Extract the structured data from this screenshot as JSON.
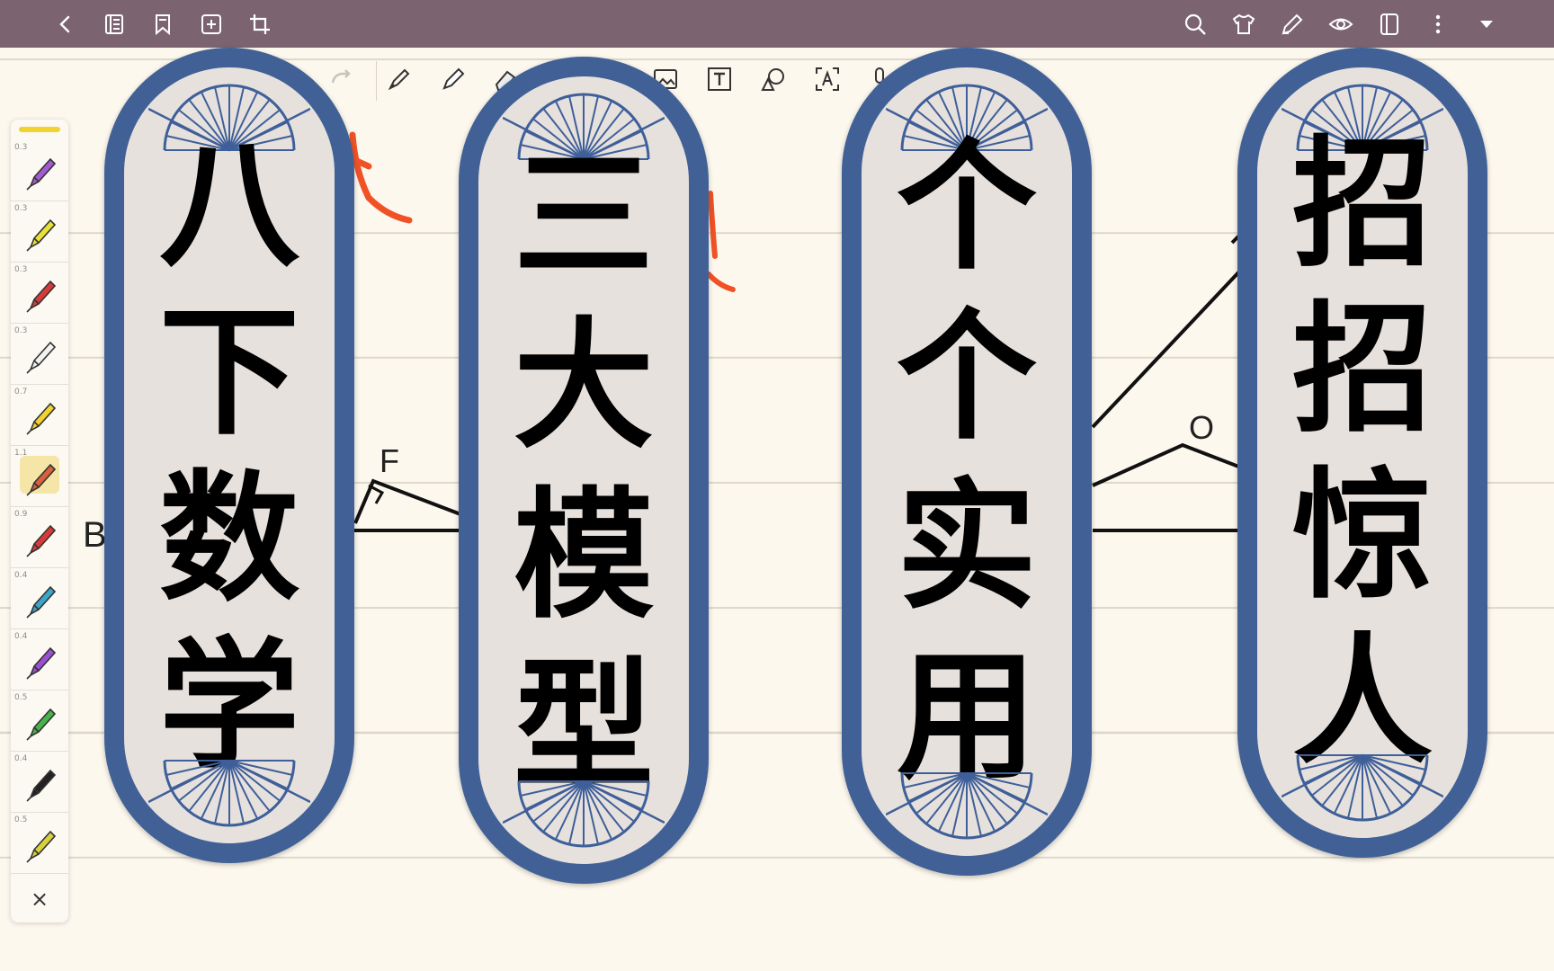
{
  "topbar": {
    "background": "#7b6470",
    "left_icons": [
      "back-icon",
      "outline-icon",
      "bookmark-icon",
      "add-page-icon",
      "crop-icon"
    ],
    "right_icons": [
      "search-icon",
      "shirt-icon",
      "pen-mode-icon",
      "eye-icon",
      "page-view-icon",
      "more-icon",
      "dropdown-icon"
    ]
  },
  "toolbar2": {
    "icons": [
      "redo-icon",
      "pen-tool-icon",
      "fountain-pen-icon",
      "eraser-icon",
      "image-icon",
      "text-box-icon",
      "shape-icon",
      "text-recognition-icon",
      "mic-icon"
    ]
  },
  "palette": {
    "pens": [
      {
        "size": "0.3",
        "color": "#a45ad1",
        "icon": "fineliner-icon"
      },
      {
        "size": "0.3",
        "color": "#e9e03a",
        "icon": "fineliner-icon"
      },
      {
        "size": "0.3",
        "color": "#d83a3a",
        "icon": "fineliner-icon"
      },
      {
        "size": "0.3",
        "color": "#f2f2f2",
        "icon": "fineliner-icon"
      },
      {
        "size": "0.7",
        "color": "#f1d32f",
        "icon": "highlighter-icon"
      },
      {
        "size": "1.1",
        "color": "#d8613a",
        "icon": "brush-pen-icon",
        "active": true
      },
      {
        "size": "0.9",
        "color": "#d83a3a",
        "icon": "ballpoint-icon"
      },
      {
        "size": "0.4",
        "color": "#3aa6c9",
        "icon": "ballpoint-icon"
      },
      {
        "size": "0.4",
        "color": "#9b4fd1",
        "icon": "ballpoint-icon"
      },
      {
        "size": "0.5",
        "color": "#45b347",
        "icon": "ballpoint-icon"
      },
      {
        "size": "0.4",
        "color": "#222222",
        "icon": "ballpoint-icon"
      },
      {
        "size": "0.5",
        "color": "#d7d23c",
        "icon": "ballpoint-icon"
      }
    ],
    "close_label": "×"
  },
  "drawing": {
    "labels": {
      "b": "B",
      "f": "F",
      "o": "O"
    }
  },
  "banners": [
    {
      "chars": [
        "八",
        "下",
        "数",
        "学"
      ]
    },
    {
      "chars": [
        "三",
        "大",
        "模",
        "型"
      ]
    },
    {
      "chars": [
        "个",
        "个",
        "实",
        "用"
      ]
    },
    {
      "chars": [
        "招",
        "招",
        "惊",
        "人"
      ]
    }
  ],
  "colors": {
    "banner_border": "#416196",
    "banner_fill": "#e7e1dd",
    "paper": "#fdf8ee"
  }
}
